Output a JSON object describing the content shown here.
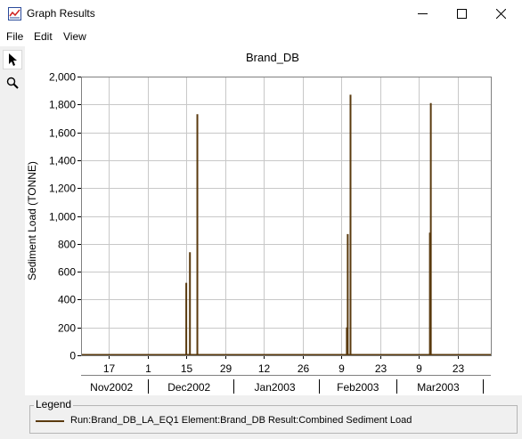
{
  "window": {
    "title": "Graph Results"
  },
  "menu": {
    "items": [
      "File",
      "Edit",
      "View"
    ]
  },
  "tools": [
    "pointer-tool",
    "zoom-tool"
  ],
  "colors": {
    "series": "#5a3a0e",
    "grid": "#c8c8c8"
  },
  "legend": {
    "title": "Legend",
    "entry": "Run:Brand_DB_LA_EQ1 Element:Brand_DB Result:Combined Sediment Load"
  },
  "chart_data": {
    "type": "line",
    "title": "Brand_DB",
    "ylabel": "Sediment Load (TONNE)",
    "xlabel": "",
    "ylim": [
      0,
      2000
    ],
    "yticks": [
      "0",
      "200",
      "400",
      "600",
      "800",
      "1,000",
      "1,200",
      "1,400",
      "1,600",
      "1,800",
      "2,000"
    ],
    "xlim": [
      "2002-11-07",
      "2003-04-04"
    ],
    "day_ticks": [
      {
        "date": "2002-11-17",
        "label": "17"
      },
      {
        "date": "2002-12-01",
        "label": "1"
      },
      {
        "date": "2002-12-15",
        "label": "15"
      },
      {
        "date": "2002-12-29",
        "label": "29"
      },
      {
        "date": "2003-01-12",
        "label": "12"
      },
      {
        "date": "2003-01-26",
        "label": "26"
      },
      {
        "date": "2003-02-09",
        "label": "9"
      },
      {
        "date": "2003-02-23",
        "label": "23"
      },
      {
        "date": "2003-03-09",
        "label": "9"
      },
      {
        "date": "2003-03-23",
        "label": "23"
      }
    ],
    "month_labels": [
      {
        "date": "2002-11-18",
        "label": "Nov2002"
      },
      {
        "date": "2002-12-16",
        "label": "Dec2002"
      },
      {
        "date": "2003-01-16",
        "label": "Jan2003"
      },
      {
        "date": "2003-02-15",
        "label": "Feb2003"
      },
      {
        "date": "2003-03-16",
        "label": "Mar2003"
      }
    ],
    "month_boundaries": [
      "2002-12-01",
      "2003-01-01",
      "2003-02-01",
      "2003-03-01",
      "2003-04-01"
    ],
    "grid": true,
    "series": [
      {
        "name": "Run:Brand_DB_LA_EQ1 Element:Brand_DB Result:Combined Sediment Load",
        "spikes": [
          {
            "date": "2002-12-15",
            "value": 520
          },
          {
            "date": "2002-12-16",
            "value": 740
          },
          {
            "date": "2002-12-19",
            "value": 1730
          },
          {
            "date": "2003-02-11",
            "value": 870
          },
          {
            "date": "2003-02-11",
            "value": 200
          },
          {
            "date": "2003-02-12",
            "value": 1870
          },
          {
            "date": "2003-03-13",
            "value": 880
          },
          {
            "date": "2003-03-13",
            "value": 1810
          }
        ]
      }
    ]
  }
}
